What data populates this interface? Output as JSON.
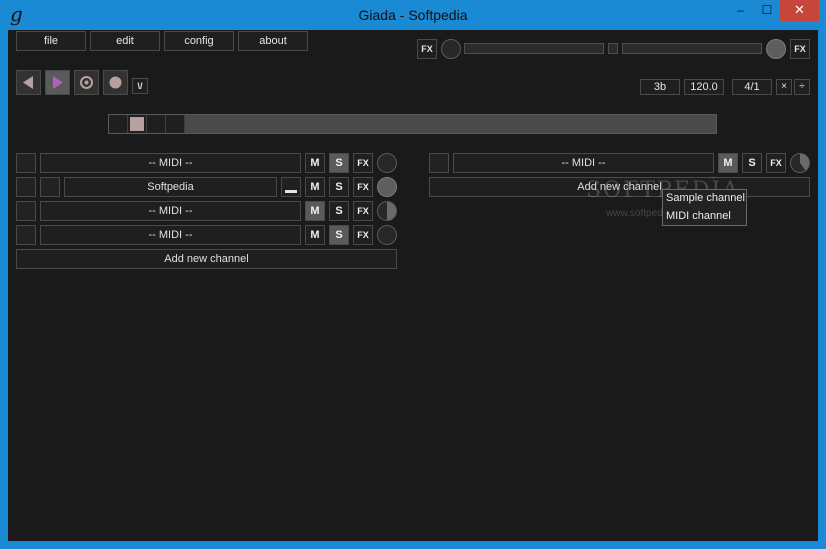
{
  "window": {
    "title": "Giada - Softpedia",
    "app_icon": "g",
    "minimize": "–",
    "maximize": "☐",
    "close": "✕"
  },
  "menu": {
    "file": "file",
    "edit": "edit",
    "config": "config",
    "about": "about"
  },
  "master": {
    "fx_in": "FX",
    "fx_out": "FX"
  },
  "transport": {
    "input_toggle": "\\/"
  },
  "timing": {
    "beats": "3b",
    "bpm": "120.0",
    "meter": "4/1",
    "multiply": "×",
    "divide": "÷"
  },
  "beat_meter": {
    "active_beat_index": 1
  },
  "left_column": {
    "channels": [
      {
        "name": "-- MIDI --",
        "mute": "M",
        "solo": "S",
        "fx": "FX",
        "mute_on": false,
        "solo_on": true,
        "dial": "empty"
      },
      {
        "name": "Softpedia",
        "mute": "M",
        "solo": "S",
        "fx": "FX",
        "mute_on": false,
        "solo_on": false,
        "dial": "filled",
        "type": "sample"
      },
      {
        "name": "-- MIDI --",
        "mute": "M",
        "solo": "S",
        "fx": "FX",
        "mute_on": true,
        "solo_on": false,
        "dial": "half"
      },
      {
        "name": "-- MIDI --",
        "mute": "M",
        "solo": "S",
        "fx": "FX",
        "mute_on": false,
        "solo_on": true,
        "dial": "empty"
      }
    ],
    "add_channel": "Add new channel"
  },
  "right_column": {
    "channels": [
      {
        "name": "-- MIDI --",
        "mute": "M",
        "solo": "S",
        "fx": "FX",
        "mute_on": true,
        "solo_on": false,
        "dial": "partial"
      }
    ],
    "add_channel": "Add new channel"
  },
  "context_menu": {
    "items": [
      "Sample channel",
      "MIDI channel"
    ]
  },
  "watermark": {
    "brand": "SOFTPEDIA",
    "url": "www.softpedia.com",
    "tm": "™"
  },
  "colors": {
    "titlebar": "#1a8ad4",
    "background": "#1a1a1a",
    "accent": "#b060c0",
    "close_button": "#c7463c"
  }
}
